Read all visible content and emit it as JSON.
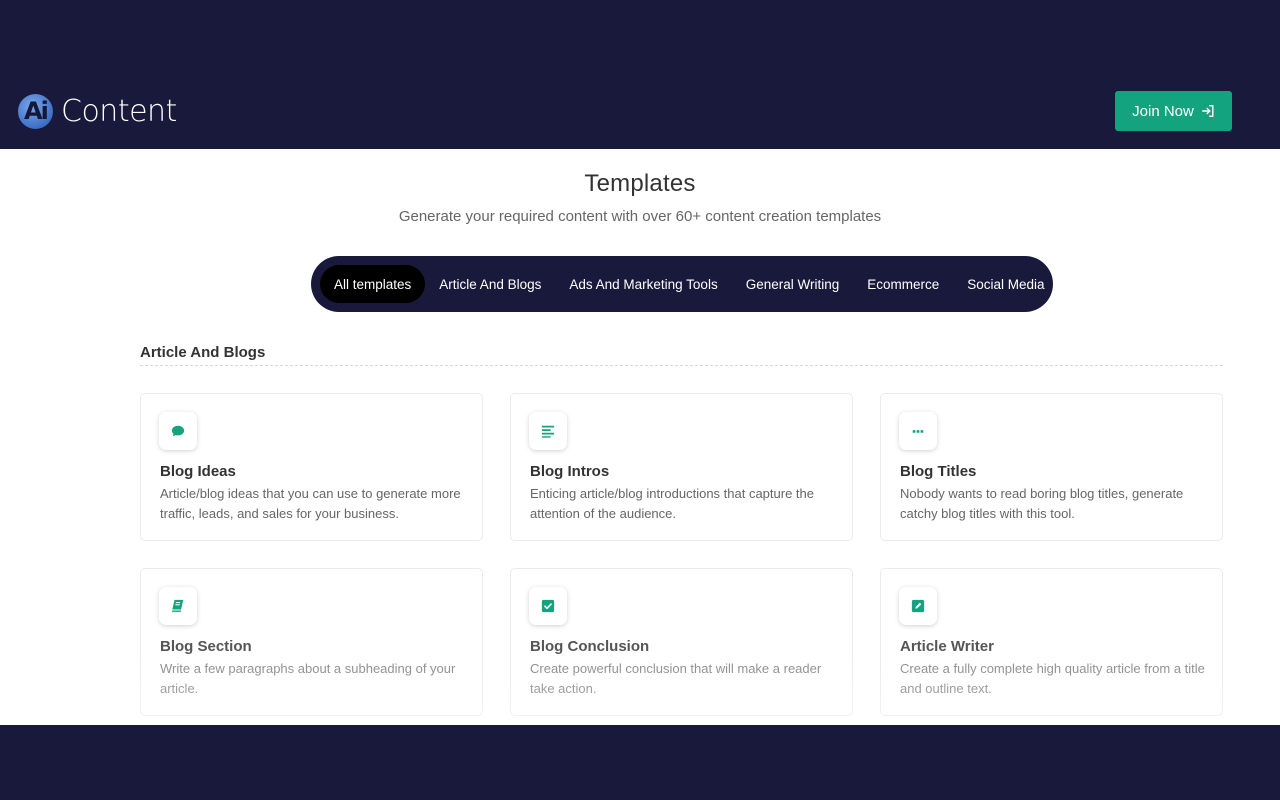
{
  "header": {
    "logo_mark": "Ai",
    "logo_text": "Content",
    "join_label": "Join Now"
  },
  "page": {
    "title": "Templates",
    "subtitle": "Generate your required content with over 60+ content creation templates"
  },
  "tabs": [
    {
      "label": "All templates",
      "active": true
    },
    {
      "label": "Article And Blogs",
      "active": false
    },
    {
      "label": "Ads And Marketing Tools",
      "active": false
    },
    {
      "label": "General Writing",
      "active": false
    },
    {
      "label": "Ecommerce",
      "active": false
    },
    {
      "label": "Social Media",
      "active": false
    }
  ],
  "section": {
    "heading": "Article And Blogs",
    "cards": [
      {
        "icon": "chat-bubble-icon",
        "title": "Blog Ideas",
        "description": "Article/blog ideas that you can use to generate more traffic, leads, and sales for your business."
      },
      {
        "icon": "text-align-icon",
        "title": "Blog Intros",
        "description": "Enticing article/blog introductions that capture the attention of the audience."
      },
      {
        "icon": "ellipsis-icon",
        "title": "Blog Titles",
        "description": "Nobody wants to read boring blog titles, generate catchy blog titles with this tool."
      },
      {
        "icon": "book-icon",
        "title": "Blog Section",
        "description": "Write a few paragraphs about a subheading of your article."
      },
      {
        "icon": "check-square-icon",
        "title": "Blog Conclusion",
        "description": "Create powerful conclusion that will make a reader take action."
      },
      {
        "icon": "edit-square-icon",
        "title": "Article Writer",
        "description": "Create a fully complete high quality article from a title and outline text."
      }
    ]
  },
  "colors": {
    "navy": "#191a3b",
    "accent_green": "#14a37f",
    "tab_active": "#000000"
  }
}
